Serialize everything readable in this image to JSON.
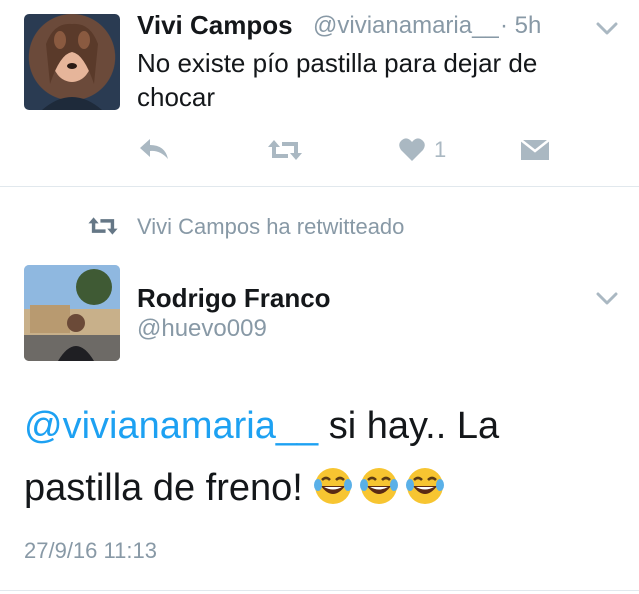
{
  "tweet1": {
    "name": "Vivi Campos",
    "handle": "@vivianamaria__",
    "time": "· 5h",
    "text": "No existe pío pastilla para dejar de chocar",
    "like_count": "1"
  },
  "retweet_context": {
    "label": "Vivi Campos ha retwitteado"
  },
  "tweet2": {
    "name": "Rodrigo Franco",
    "handle": "@huevo009",
    "mention": "@vivianamaria__",
    "text_rest": " si hay.. La pastilla de freno! ",
    "timestamp": "27/9/16 11:13"
  },
  "icons": [
    "chevron-down-icon",
    "reply-icon",
    "retweet-icon",
    "heart-icon",
    "message-icon",
    "laughing-emoji-icon"
  ],
  "colors": {
    "accent": "#1da1f2",
    "muted": "#8899a6",
    "icon": "#aab8c2",
    "divider": "#e1e8ed"
  }
}
